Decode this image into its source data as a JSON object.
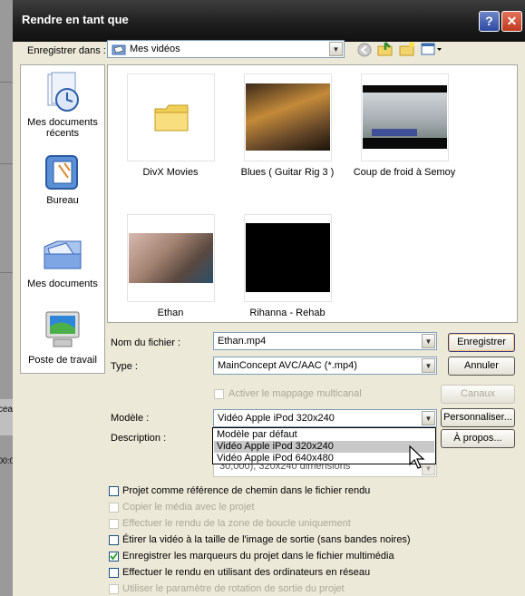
{
  "window": {
    "title": "Rendre en tant que",
    "help": "?",
    "close": "✕"
  },
  "save_in": {
    "label": "Enregistrer dans :",
    "value": "Mes vidéos"
  },
  "places": [
    {
      "label": "Mes documents récents",
      "icon": "recent-documents-icon"
    },
    {
      "label": "Bureau",
      "icon": "desktop-icon"
    },
    {
      "label": "Mes documents",
      "icon": "my-documents-icon"
    },
    {
      "label": "Poste de travail",
      "icon": "my-computer-icon"
    }
  ],
  "files": [
    {
      "label": "DivX Movies",
      "kind": "folder"
    },
    {
      "label": "Blues ( Guitar Rig 3 )",
      "kind": "video"
    },
    {
      "label": "Coup de froid à Semoy",
      "kind": "video"
    },
    {
      "label": "Ethan",
      "kind": "video"
    },
    {
      "label": "Rihanna - Rehab",
      "kind": "video"
    }
  ],
  "form": {
    "filename_label": "Nom du fichier :",
    "filename_value": "Ethan.mp4",
    "type_label": "Type :",
    "type_value": "MainConcept AVC/AAC (*.mp4)",
    "save_button": "Enregistrer",
    "cancel_button": "Annuler",
    "multichannel_label": "Activer le mappage multicanal",
    "channels_button": "Canaux",
    "template_label": "Modèle :",
    "template_value": "Vidéo Apple iPod 320x240",
    "customize_button": "Personnaliser...",
    "description_label": "Description :",
    "description_partial": "30,000), 320x240 dimensions",
    "about_button": "À propos...",
    "dropdown_options": [
      "Modèle par défaut",
      "Vidéo Apple iPod 320x240",
      "Vidéo Apple iPod 640x480"
    ],
    "dropdown_selected_index": 1
  },
  "options": [
    {
      "label": "Projet comme référence de chemin dans le fichier rendu",
      "checked": false,
      "enabled": true
    },
    {
      "label": "Copier  le média avec le projet",
      "checked": false,
      "enabled": false
    },
    {
      "label": "Effectuer le rendu de la zone de boucle uniquement",
      "checked": false,
      "enabled": false
    },
    {
      "label": "Étirer la vidéo à la taille de l'image de sortie (sans bandes noires)",
      "checked": false,
      "enabled": true
    },
    {
      "label": "Enregistrer les marqueurs du projet dans le fichier multimédia",
      "checked": true,
      "enabled": true
    },
    {
      "label": "Effectuer le rendu en utilisant des ordinateurs en réseau",
      "checked": false,
      "enabled": true
    },
    {
      "label": "Utiliser le paramètre de rotation de sortie du projet",
      "checked": false,
      "enabled": false
    }
  ],
  "background_fragments": {
    "left_text": "ceau",
    "left_time": "00:0"
  },
  "colors": {
    "titlebar": "#1d1d1d",
    "dialog": "#ece9d8",
    "selected_option": "#c8c8c8"
  }
}
